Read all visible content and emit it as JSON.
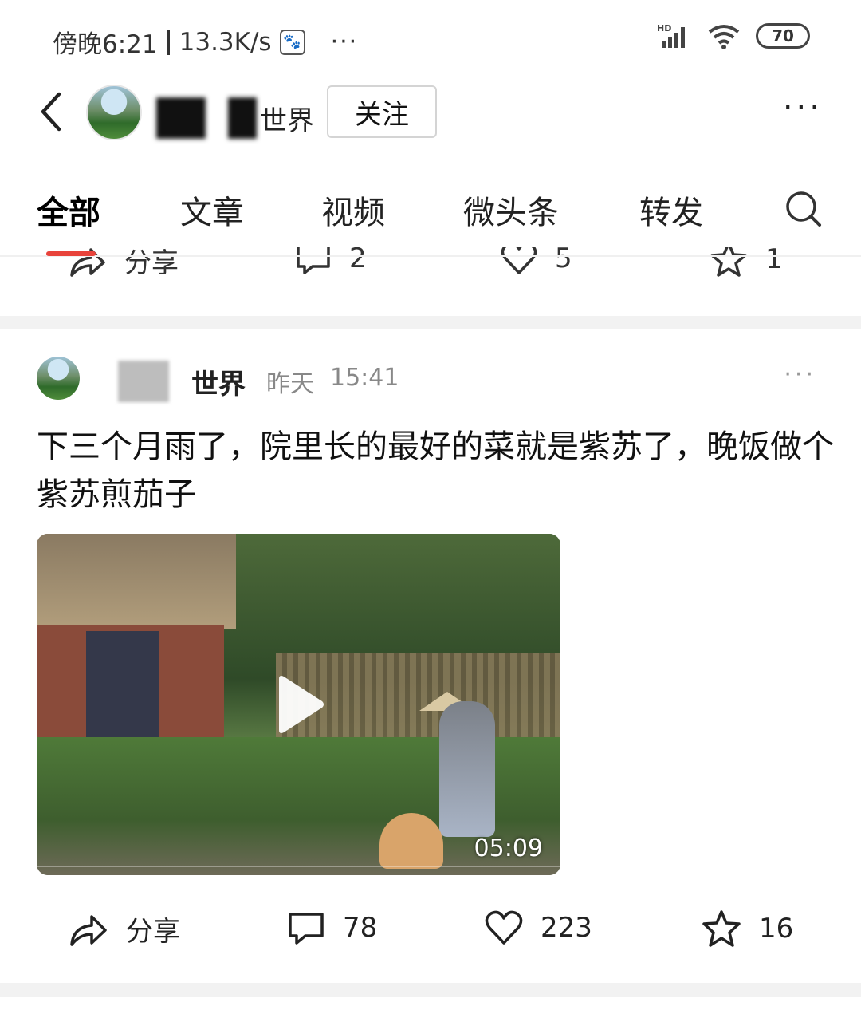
{
  "status_bar": {
    "time": "傍晚6:21",
    "network_speed": "13.3K/s",
    "baidu_icon": "baidu-paw-icon",
    "more": "···",
    "signal_label": "HD",
    "battery": "70"
  },
  "header": {
    "author_name_visible": "世界",
    "follow_label": "关注",
    "more": "···"
  },
  "tabs": [
    {
      "label": "全部",
      "active": true
    },
    {
      "label": "文章",
      "active": false
    },
    {
      "label": "视频",
      "active": false
    },
    {
      "label": "微头条",
      "active": false
    },
    {
      "label": "转发",
      "active": false
    }
  ],
  "prev_post_actions": {
    "share_label": "分享",
    "comments": "2",
    "likes": "5",
    "favorites": "1"
  },
  "post": {
    "author_visible": "世界",
    "time_day": "昨天",
    "time_clock": "15:41",
    "more": "···",
    "text": "下三个月雨了，院里长的最好的菜就是紫苏了，晚饭做个紫苏煎茄子",
    "video_duration": "05:09",
    "actions": {
      "share_label": "分享",
      "comments": "78",
      "likes": "223",
      "favorites": "16"
    }
  },
  "colors": {
    "accent_red": "#e8433b",
    "divider": "#f2f2f2",
    "text_gray": "#888888"
  }
}
